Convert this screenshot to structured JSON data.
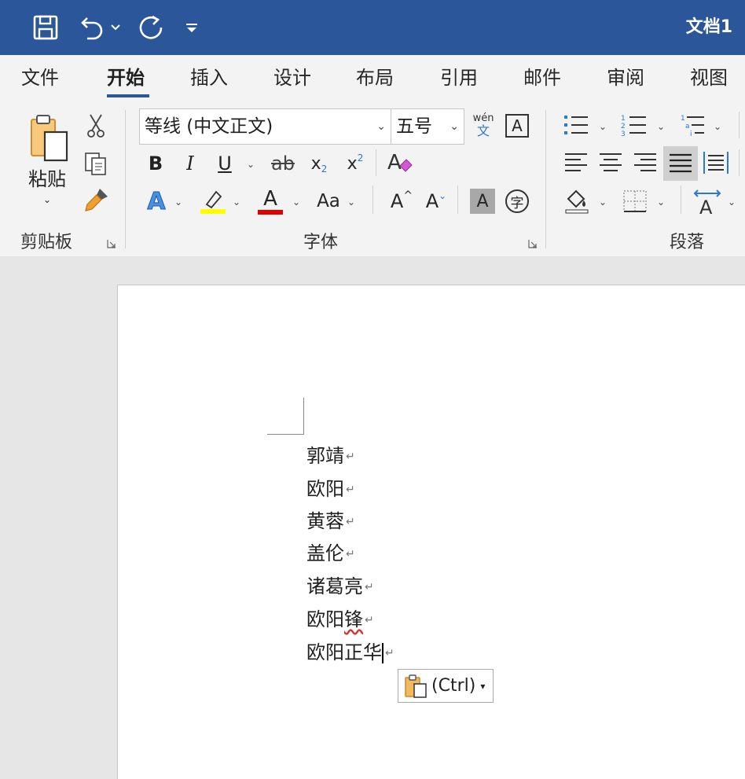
{
  "titlebar": {
    "doc_title": "文档1",
    "qat": [
      "save-icon",
      "undo-icon",
      "redo-icon",
      "customize-qat-icon"
    ],
    "color": "#2b579a"
  },
  "tabs": [
    {
      "label": "文件",
      "active": false
    },
    {
      "label": "开始",
      "active": true
    },
    {
      "label": "插入",
      "active": false
    },
    {
      "label": "设计",
      "active": false
    },
    {
      "label": "布局",
      "active": false
    },
    {
      "label": "引用",
      "active": false
    },
    {
      "label": "邮件",
      "active": false
    },
    {
      "label": "审阅",
      "active": false
    },
    {
      "label": "视图",
      "active": false
    }
  ],
  "ribbon": {
    "clipboard": {
      "label": "剪贴板",
      "paste_label": "粘贴"
    },
    "font": {
      "label": "字体",
      "font_name": "等线 (中文正文)",
      "font_size": "五号",
      "phonetic_top": "wén",
      "phonetic_bottom": "文",
      "bold": "B",
      "italic": "I",
      "underline": "U",
      "strike": "ab",
      "subscript": "x",
      "superscript": "x",
      "text_effects": "A",
      "font_color": "A",
      "change_case": "Aa",
      "grow": "A",
      "shrink": "A",
      "char_shading": "A",
      "enclose": "字",
      "highlight_color": "#ffff00",
      "font_color_value": "#e00000"
    },
    "paragraph": {
      "label": "段落"
    }
  },
  "document": {
    "lines": [
      {
        "text": "郭靖",
        "spell_error": false,
        "caret": false
      },
      {
        "text": "欧阳",
        "spell_error": false,
        "caret": false
      },
      {
        "text": "黄蓉",
        "spell_error": false,
        "caret": false
      },
      {
        "text": "盖伦",
        "spell_error": false,
        "caret": false
      },
      {
        "text": "诸葛亮",
        "spell_error": false,
        "caret": false
      },
      {
        "text_before": "欧阳",
        "text_error": "锋",
        "spell_error": true,
        "caret": false
      },
      {
        "text": "欧阳正华",
        "spell_error": false,
        "caret": true
      }
    ],
    "paste_options_label": "(Ctrl)"
  }
}
